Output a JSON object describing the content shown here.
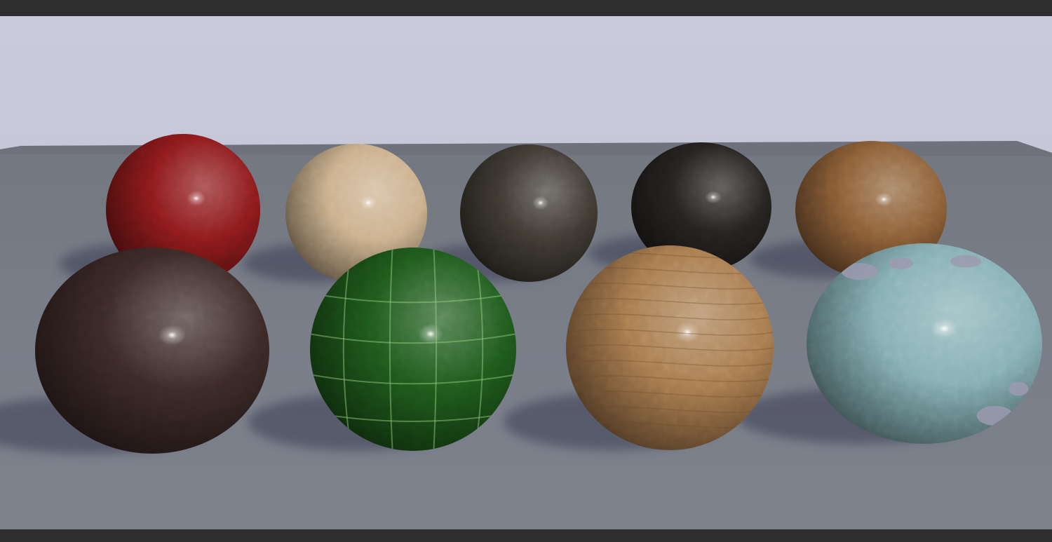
{
  "scene": {
    "sky_color": "#c3c3d6",
    "floor_color": "#757985",
    "letterbox_color": "#2e2e2e",
    "spheres": [
      {
        "name": "red-lacquered-wood-sphere",
        "color": "#8e1a1c"
      },
      {
        "name": "light-plywood-sphere",
        "color": "#cbb08d"
      },
      {
        "name": "tree-bark-sphere",
        "color": "#3f3a33"
      },
      {
        "name": "dark-charcoal-sphere",
        "color": "#262321"
      },
      {
        "name": "wood-parquet-sphere",
        "color": "#8e6038"
      },
      {
        "name": "cracked-leather-sphere",
        "color": "#3c2a28"
      },
      {
        "name": "green-glazed-tile-sphere",
        "color": "#1f5a1c"
      },
      {
        "name": "polished-wood-grain-sphere",
        "color": "#a97c4f"
      },
      {
        "name": "chipped-teal-paint-sphere",
        "color": "#86b0b5"
      }
    ]
  }
}
